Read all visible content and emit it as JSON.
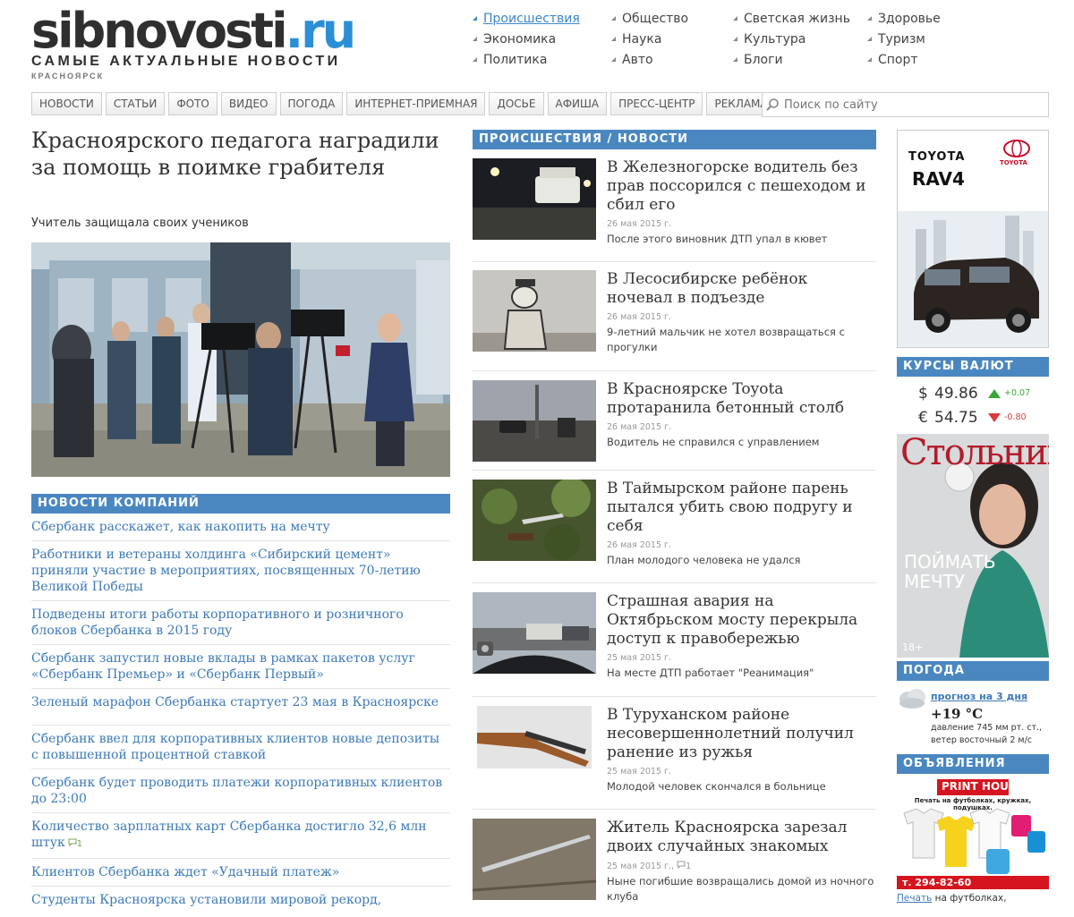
{
  "header": {
    "logo_main": "sibnovosti",
    "logo_tld": ".ru",
    "tagline": "САМЫЕ АКТУАЛЬНЫЕ НОВОСТИ",
    "city": "КРАСНОЯРСК",
    "categories": [
      "Происшествия",
      "Общество",
      "Светская жизнь",
      "Здоровье",
      "Экономика",
      "Наука",
      "Культура",
      "Туризм",
      "Политика",
      "Авто",
      "Блоги",
      "Спорт"
    ],
    "active_category": "Происшествия"
  },
  "nav": {
    "items": [
      "НОВОСТИ",
      "СТАТЬИ",
      "ФОТО",
      "ВИДЕО",
      "ПОГОДА",
      "ИНТЕРНЕТ-ПРИЕМНАЯ",
      "ДОСЬЕ",
      "АФИША",
      "ПРЕСС-ЦЕНТР",
      "РЕКЛАМА"
    ],
    "search_placeholder": "Поиск по сайту"
  },
  "lead": {
    "title": "Красноярского педагога наградили за помощь в поимке грабителя",
    "subtitle": "Учитель защищала своих учеников"
  },
  "company_news": {
    "heading": "НОВОСТИ КОМПАНИЙ",
    "items": [
      {
        "text": "Сбербанк расскажет, как накопить на мечту",
        "count": ""
      },
      {
        "text": "Работники и ветераны холдинга «Сибирский цемент» приняли участие в мероприятиях, посвященных 70-летию Великой Победы",
        "count": ""
      },
      {
        "text": "Подведены итоги работы корпоративного и розничного блоков Сбербанка в 2015 году",
        "count": ""
      },
      {
        "text": "Сбербанк запустил новые вклады в рамках пакетов услуг «Сбербанк Премьер» и «Сбербанк Первый»",
        "count": ""
      },
      {
        "text": "Зеленый марафон Сбербанка стартует 23 мая в Красноярске",
        "count": ""
      },
      {
        "text": "Сбербанк ввел для корпоративных клиентов новые депозиты с повышенной процентной ставкой",
        "count": ""
      },
      {
        "text": "Сбербанк будет проводить платежи корпоративных клиентов до 23:00",
        "count": ""
      },
      {
        "text": "Количество зарплатных карт Сбербанка достигло 32,6 млн штук",
        "count": "1"
      },
      {
        "text": "Клиентов Сбербанка ждет «Удачный платеж»",
        "count": ""
      },
      {
        "text": "Студенты Красноярска установили мировой рекорд,",
        "count": ""
      }
    ]
  },
  "news": {
    "heading": "ПРОИСШЕСТВИЯ / НОВОСТИ",
    "items": [
      {
        "title": "В Железногорске водитель без прав поссорился с пешеходом и сбил его",
        "date": "26 мая 2015 г.",
        "comments": "",
        "lead": "После этого виновник ДТП упал в кювет"
      },
      {
        "title": "В Лесосибирске ребёнок ночевал в подъезде",
        "date": "26 мая 2015 г.",
        "comments": "",
        "lead": "9-летний мальчик не хотел возвращаться с прогулки"
      },
      {
        "title": "В Красноярске Toyota протаранила бетонный столб",
        "date": "26 мая 2015 г.",
        "comments": "",
        "lead": "Водитель не справился с управлением"
      },
      {
        "title": "В Таймырском районе парень пытался убить свою подругу и себя",
        "date": "26 мая 2015 г.",
        "comments": "",
        "lead": "План молодого человека не удался"
      },
      {
        "title": "Страшная авария на Октябрьском мосту перекрыла доступ к правобережью",
        "date": "25 мая 2015 г.",
        "comments": "",
        "lead": "На месте ДТП работает \"Реанимация\""
      },
      {
        "title": "В Туруханском районе несовершеннолетний получил ранение из ружья",
        "date": "25 мая 2015 г.",
        "comments": "",
        "lead": "Молодой человек скончался в больнице"
      },
      {
        "title": "Житель Красноярска зарезал двоих случайных знакомых",
        "date": "25 мая 2015 г.,",
        "comments": "1",
        "lead": "Ныне погибшие возвращались домой из ночного клуба"
      }
    ]
  },
  "sidebar": {
    "toyota_ad": {
      "brand": "TOYOTA",
      "model": "RAV4",
      "logo_text": "TOYOTA"
    },
    "rates": {
      "heading": "КУРСЫ ВАЛЮТ",
      "items": [
        {
          "symbol": "$",
          "value": "49.86",
          "change": "+0.07",
          "dir": "up"
        },
        {
          "symbol": "€",
          "value": "54.75",
          "change": "-0.80",
          "dir": "down"
        }
      ]
    },
    "magazine": {
      "title": "Стольник",
      "cover_text": "ПОЙМАТЬ МЕЧТУ",
      "age": "18+"
    },
    "weather": {
      "heading": "ПОГОДА",
      "forecast_link": "прогноз на 3 дня",
      "temp": "+19 °С",
      "pressure": "давление 745 мм рт. ст.,",
      "wind": "ветер восточный 2 м/с"
    },
    "ads": {
      "heading": "ОБЪЯВЛЕНИЯ",
      "print_brand": "PRINT HOUSE",
      "print_slogan": "Печать на футболках, кружках, подушках.",
      "print_phone": "т. 294-82-60",
      "caption_link": "Печать",
      "caption_rest": " на футболках,"
    }
  },
  "colors": {
    "accent": "#4a87c1",
    "link": "#3d7ab8",
    "logo_blue": "#2a8fd6",
    "up": "#3aa63a",
    "down": "#d93c3c"
  }
}
